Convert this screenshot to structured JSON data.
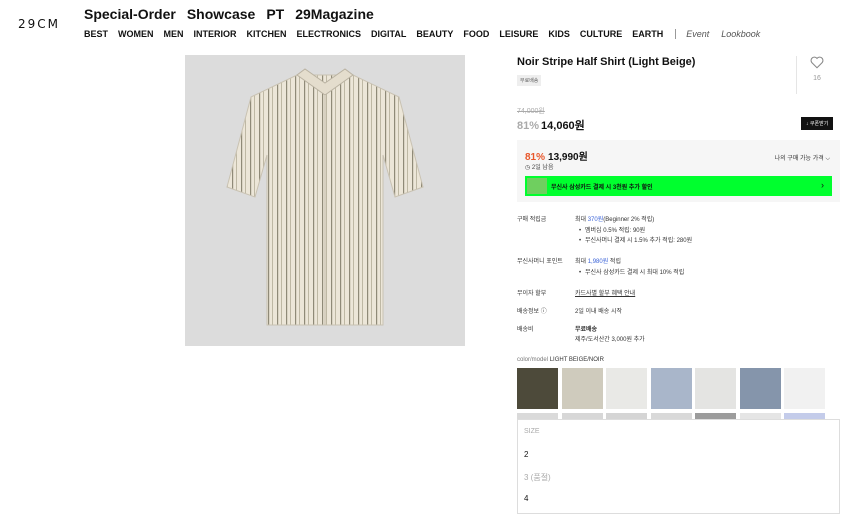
{
  "brand": {
    "logo": "29CM"
  },
  "top_nav": [
    "Special-Order",
    "Showcase",
    "PT",
    "29Magazine"
  ],
  "category_nav": [
    "BEST",
    "WOMEN",
    "MEN",
    "INTERIOR",
    "KITCHEN",
    "ELECTRONICS",
    "DIGITAL",
    "BEAUTY",
    "FOOD",
    "LEISURE",
    "KIDS",
    "CULTURE",
    "EARTH"
  ],
  "category_nav_extra": [
    "Event",
    "Lookbook"
  ],
  "product": {
    "name": "Noir Stripe Half Shirt (Light Beige)",
    "tag": "무료배송",
    "likes": "16",
    "original_price": "74,000원",
    "discount_pct": "81%",
    "price": "14,060원",
    "coupon_button": "↓ 쿠폰받기"
  },
  "my_price": {
    "pct": "81%",
    "price": "13,990원",
    "deadline": "2일 남음",
    "label": "나의 구매 가능 가격"
  },
  "card_banner": {
    "text": "무신사 삼성카드 결제 시 3천원 추가 할인"
  },
  "benefits": {
    "purchase_points": {
      "label": "구매 적립금",
      "prefix": "최대 ",
      "amount": "370원",
      "suffix": "(Beginner 2% 적립)",
      "items": [
        "멤버십 0.5% 적립: 90원",
        "무신사머니 결제 시 1.5% 추가 적립: 280원"
      ]
    },
    "musinsa_money": {
      "label": "무신사머니 포인트",
      "prefix": "최대 ",
      "amount": "1,980원",
      "suffix": " 적립",
      "items": [
        "무신사 삼성카드 결제 시 최대 10% 적립"
      ]
    },
    "installment": {
      "label": "무이자 할부",
      "value": "카드사별 할부 혜택 안내"
    },
    "shipping_info": {
      "label": "배송정보",
      "value": "2일 이내 배송 시작"
    },
    "shipping_fee": {
      "label": "배송비",
      "value": "무료배송",
      "note": "제주/도서산간 3,000원 추가"
    }
  },
  "color_model": {
    "label": "color/model",
    "value": "LIGHT BEIGE/NOIR"
  },
  "swatch_colors": [
    "#4d4a3a",
    "#cfcbbd",
    "#e9e9e6",
    "#a9b6ca",
    "#e4e4e2",
    "#8595ab",
    "#f1f1f1"
  ],
  "swatch_colors_row2": [
    "#dadada",
    "#d7d7d7",
    "#d5d5d5",
    "#d9d9d9",
    "#9c9c9c",
    "#e5e5e5",
    "#c4ccea"
  ],
  "size_dropdown": {
    "title": "SIZE",
    "options": [
      "2",
      "3 (품절)",
      "4"
    ]
  }
}
